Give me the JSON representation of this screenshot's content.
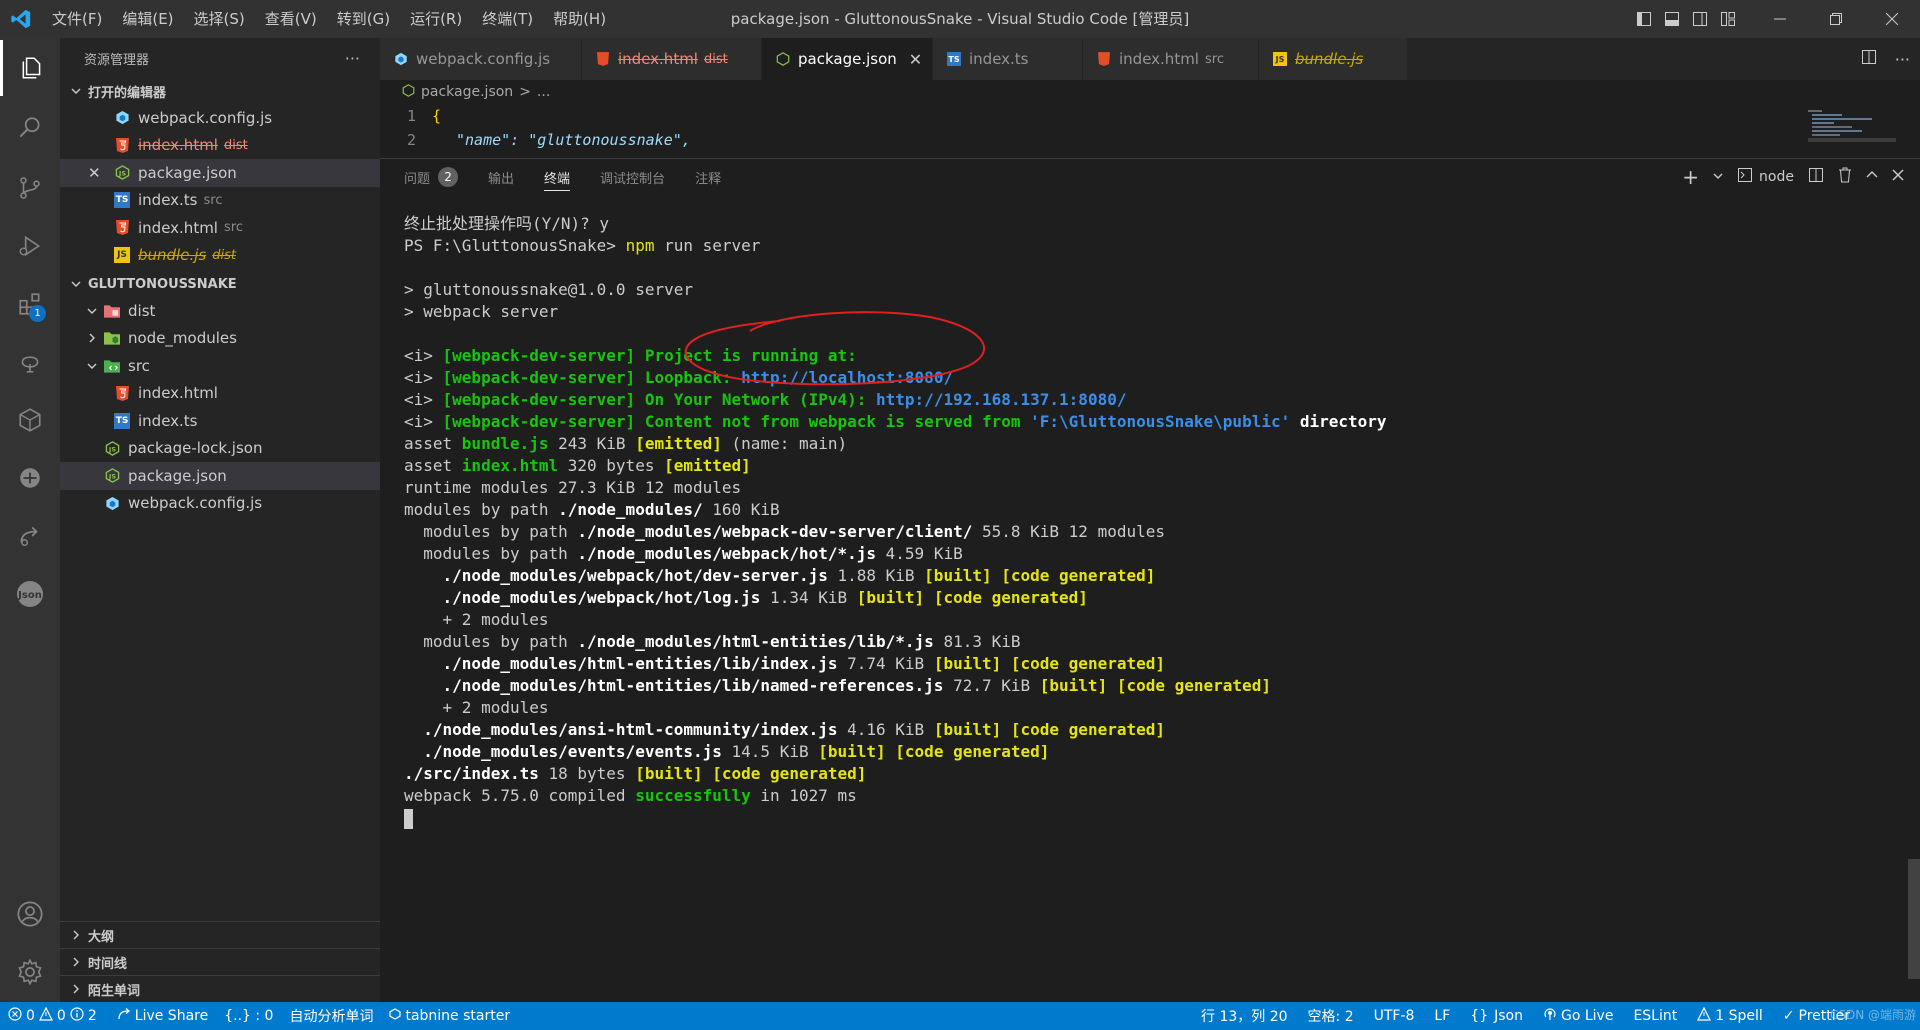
{
  "window": {
    "title": "package.json - GluttonousSnake - Visual Studio Code [管理员]",
    "menu": [
      "文件(F)",
      "编辑(E)",
      "选择(S)",
      "查看(V)",
      "转到(G)",
      "运行(R)",
      "终端(T)",
      "帮助(H)"
    ]
  },
  "activity": {
    "extensions_badge": "1"
  },
  "sidebar": {
    "title": "资源管理器",
    "more": "···",
    "open_editors_label": "打开的编辑器",
    "open_editors": [
      {
        "name": "webpack.config.js",
        "desc": "",
        "icon": "webpack"
      },
      {
        "name": "index.html",
        "desc": "dist",
        "icon": "html"
      },
      {
        "name": "package.json",
        "desc": "",
        "icon": "node"
      },
      {
        "name": "index.ts",
        "desc": "src",
        "icon": "ts"
      },
      {
        "name": "index.html",
        "desc": "src",
        "icon": "html"
      },
      {
        "name": "bundle.js",
        "desc": "dist",
        "icon": "js"
      }
    ],
    "project_label": "GLUTTONOUSSNAKE",
    "tree": [
      {
        "name": "dist"
      },
      {
        "name": "node_modules"
      },
      {
        "name": "src"
      },
      {
        "name": "index.html"
      },
      {
        "name": "index.ts"
      },
      {
        "name": "package-lock.json"
      },
      {
        "name": "package.json"
      },
      {
        "name": "webpack.config.js"
      }
    ],
    "bottom_sections": [
      "大纲",
      "时间线",
      "陌生单词"
    ]
  },
  "tabs": [
    {
      "name": "webpack.config.js",
      "desc": ""
    },
    {
      "name": "index.html",
      "desc": "dist"
    },
    {
      "name": "package.json",
      "desc": "",
      "close": "✕"
    },
    {
      "name": "index.ts",
      "desc": ""
    },
    {
      "name": "index.html",
      "desc": "src"
    },
    {
      "name": "bundle.js",
      "desc": ""
    }
  ],
  "breadcrumb": {
    "file": "package.json",
    "sep": ">",
    "more": "..."
  },
  "code": {
    "lines": [
      {
        "num": "1",
        "text": "{"
      },
      {
        "num": "2",
        "text": "\"name\": \"gluttonoussnake\","
      }
    ]
  },
  "panel": {
    "tabs": [
      "问题",
      "输出",
      "终端",
      "调试控制台",
      "注释"
    ],
    "problems_count": "2",
    "active_tab": "终端",
    "terminal_name": "node"
  },
  "terminal": {
    "lines": [
      [
        {
          "t": "终止批处理操作吗(Y/N)? y"
        }
      ],
      [
        {
          "t": "PS F:\\GluttonousSnake> "
        },
        {
          "t": "npm",
          "s": "y"
        },
        {
          "t": " run server"
        }
      ],
      [
        {
          "t": ""
        }
      ],
      [
        {
          "t": "> gluttonoussnake@1.0.0 server"
        }
      ],
      [
        {
          "t": "> webpack server"
        }
      ],
      [
        {
          "t": ""
        }
      ],
      [
        {
          "t": "<i> "
        },
        {
          "t": "[webpack-dev-server] Project is running at:",
          "s": "g"
        }
      ],
      [
        {
          "t": "<i> "
        },
        {
          "t": "[webpack-dev-server] Loopback: ",
          "s": "g"
        },
        {
          "t": "http://localhost:8080/",
          "s": "c"
        }
      ],
      [
        {
          "t": "<i> "
        },
        {
          "t": "[webpack-dev-server] On Your Network (IPv4): ",
          "s": "g"
        },
        {
          "t": "http://192.168.137.1:8080/",
          "s": "c"
        }
      ],
      [
        {
          "t": "<i> "
        },
        {
          "t": "[webpack-dev-server] Content not from webpack is served from ",
          "s": "g"
        },
        {
          "t": "'F:\\GluttonousSnake\\public'",
          "s": "c"
        },
        {
          "t": " directory",
          "s": "b"
        }
      ],
      [
        {
          "t": "asset "
        },
        {
          "t": "bundle.js",
          "s": "g"
        },
        {
          "t": " 243 KiB "
        },
        {
          "t": "[emitted]",
          "s": "yb"
        },
        {
          "t": " (name: main)"
        }
      ],
      [
        {
          "t": "asset "
        },
        {
          "t": "index.html",
          "s": "g"
        },
        {
          "t": " 320 bytes "
        },
        {
          "t": "[emitted]",
          "s": "yb"
        }
      ],
      [
        {
          "t": "runtime modules 27.3 KiB 12 modules"
        }
      ],
      [
        {
          "t": "modules by path "
        },
        {
          "t": "./node_modules/",
          "s": "b"
        },
        {
          "t": " 160 KiB"
        }
      ],
      [
        {
          "t": "  modules by path "
        },
        {
          "t": "./node_modules/webpack-dev-server/client/",
          "s": "b"
        },
        {
          "t": " 55.8 KiB 12 modules"
        }
      ],
      [
        {
          "t": "  modules by path "
        },
        {
          "t": "./node_modules/webpack/hot/*.js",
          "s": "b"
        },
        {
          "t": " 4.59 KiB"
        }
      ],
      [
        {
          "t": "    "
        },
        {
          "t": "./node_modules/webpack/hot/dev-server.js",
          "s": "b"
        },
        {
          "t": " 1.88 KiB "
        },
        {
          "t": "[built] [code generated]",
          "s": "yb"
        }
      ],
      [
        {
          "t": "    "
        },
        {
          "t": "./node_modules/webpack/hot/log.js",
          "s": "b"
        },
        {
          "t": " 1.34 KiB "
        },
        {
          "t": "[built] [code generated]",
          "s": "yb"
        }
      ],
      [
        {
          "t": "    + 2 modules"
        }
      ],
      [
        {
          "t": "  modules by path "
        },
        {
          "t": "./node_modules/html-entities/lib/*.js",
          "s": "b"
        },
        {
          "t": " 81.3 KiB"
        }
      ],
      [
        {
          "t": "    "
        },
        {
          "t": "./node_modules/html-entities/lib/index.js",
          "s": "b"
        },
        {
          "t": " 7.74 KiB "
        },
        {
          "t": "[built] [code generated]",
          "s": "yb"
        }
      ],
      [
        {
          "t": "    "
        },
        {
          "t": "./node_modules/html-entities/lib/named-references.js",
          "s": "b"
        },
        {
          "t": " 72.7 KiB "
        },
        {
          "t": "[built] [code generated]",
          "s": "yb"
        }
      ],
      [
        {
          "t": "    + 2 modules"
        }
      ],
      [
        {
          "t": "  "
        },
        {
          "t": "./node_modules/ansi-html-community/index.js",
          "s": "b"
        },
        {
          "t": " 4.16 KiB "
        },
        {
          "t": "[built] [code generated]",
          "s": "yb"
        }
      ],
      [
        {
          "t": "  "
        },
        {
          "t": "./node_modules/events/events.js",
          "s": "b"
        },
        {
          "t": " 14.5 KiB "
        },
        {
          "t": "[built] [code generated]",
          "s": "yb"
        }
      ],
      [
        {
          "t": "./src/index.ts",
          "s": "b"
        },
        {
          "t": " 18 bytes "
        },
        {
          "t": "[built] [code generated]",
          "s": "yb"
        }
      ],
      [
        {
          "t": "webpack 5.75.0 compiled "
        },
        {
          "t": "successfully",
          "s": "g"
        },
        {
          "t": " in 1027 ms"
        }
      ]
    ]
  },
  "statusbar": {
    "errors": "0",
    "warnings": "0",
    "info": "2",
    "live_share": "Live Share",
    "braces": "{..} : 0",
    "auto_word": "自动分析单词",
    "tabnine": "tabnine starter",
    "position": "行 13，列 20",
    "spaces": "空格: 2",
    "encoding": "UTF-8",
    "eol": "LF",
    "language": "Json",
    "golive": "Go Live",
    "eslint": "ESLint",
    "spell": "1 Spell",
    "prettier": "Prettier"
  },
  "watermark": "CSDN @端雨游",
  "colors": {
    "accent": "#007acc",
    "annotation_circle": "#e02020",
    "html_icon": "#e44d26",
    "ts_icon": "#3178c6",
    "js_icon": "#f1c40f",
    "node_icon": "#8bc34a",
    "webpack_icon": "#8ed6fb"
  }
}
